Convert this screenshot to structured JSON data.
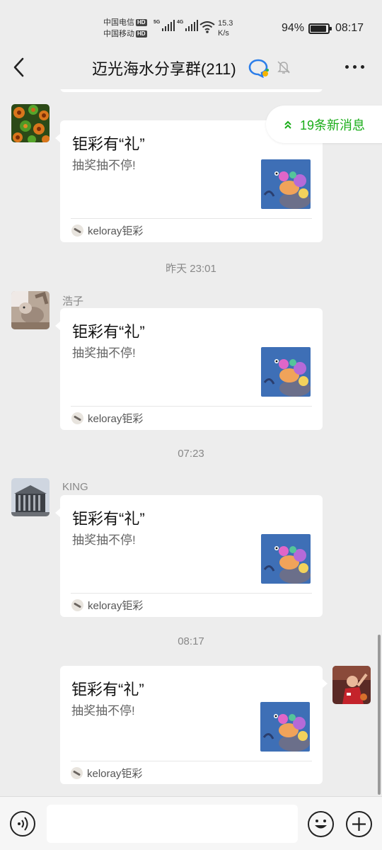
{
  "status_bar": {
    "carrier1": "中国电信",
    "carrier2": "中国移动",
    "hd_badge": "HD",
    "net1": "5G",
    "net2": "4G",
    "speed_value": "15.3",
    "speed_unit": "K/s",
    "battery": "94%",
    "battery_level": 0.94,
    "time": "08:17"
  },
  "nav": {
    "title": "迈光海水分享群(211)",
    "icons": [
      "back-icon",
      "chat-bubble-icon",
      "mute-bell-icon",
      "more-icon"
    ]
  },
  "new_messages": {
    "label": "19条新消息",
    "icon": "double-chevron-up-icon",
    "color": "#1aad19"
  },
  "card": {
    "title": "钜彩有“礼”",
    "desc": "抽奖抽不停!",
    "source": "keloray钜彩"
  },
  "messages": [
    {
      "sender": "",
      "timestamp": "",
      "side": "left"
    },
    {
      "sender": "浩子",
      "timestamp": "昨天 23:01",
      "side": "left"
    },
    {
      "sender": "KING",
      "timestamp": "07:23",
      "side": "left"
    },
    {
      "sender": "",
      "timestamp": "08:17",
      "side": "right"
    }
  ],
  "input_bar": {
    "placeholder": "",
    "icons": [
      "voice-icon",
      "emoji-icon",
      "plus-icon"
    ]
  }
}
